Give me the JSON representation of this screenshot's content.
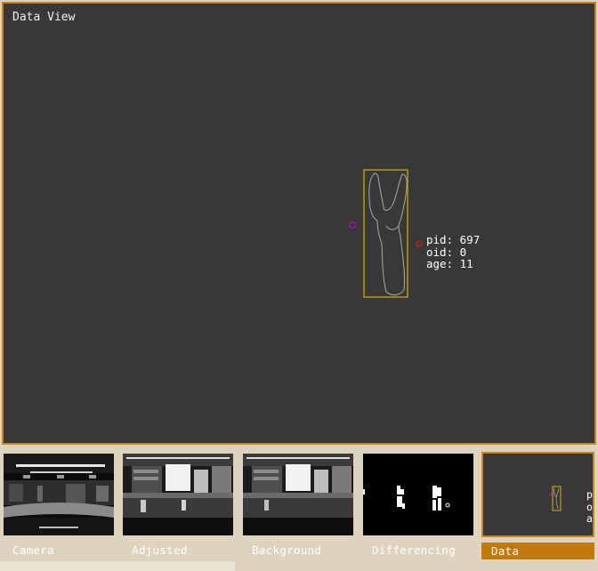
{
  "main_view": {
    "title": "Data View",
    "tracked_object": {
      "pid_label": "pid:",
      "pid_value": "697",
      "oid_label": "oid:",
      "oid_value": "0",
      "age_label": "age:",
      "age_value": "11"
    }
  },
  "thumbnails": [
    {
      "label": "Camera"
    },
    {
      "label": "Adjusted"
    },
    {
      "label": "Background"
    },
    {
      "label": "Differencing"
    },
    {
      "label": "Data",
      "active": true
    }
  ],
  "mini_readout": {
    "pid_label": "pid:",
    "oid_label": "oid:",
    "age_label": "age:"
  },
  "colors": {
    "accent": "#c8841a",
    "active_tab": "#c17a0c",
    "panel_bg": "#383838",
    "bbox": "#d8b400",
    "centroid_marker": "#c000c0",
    "anchor_marker": "#d02020"
  }
}
